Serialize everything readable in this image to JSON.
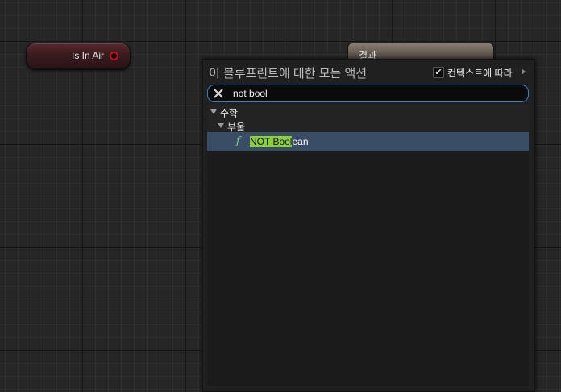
{
  "graph": {
    "node_is_in_air": {
      "label": "Is In Air"
    },
    "node_result": {
      "title": "결과"
    }
  },
  "palette": {
    "title": "이 블루프린트에 대한 모든 액션",
    "context_sensitive": {
      "label": "컨텍스트에 따라",
      "checked": true
    },
    "search": {
      "value": "not bool",
      "placeholder": ""
    },
    "categories": [
      {
        "label": "수학",
        "expanded": true
      },
      {
        "label": "부울",
        "expanded": true
      }
    ],
    "results": [
      {
        "icon": "function-icon",
        "icon_glyph": "f",
        "label_match": "NOT Bool",
        "label_rest": "ean",
        "selected": true
      }
    ]
  },
  "colors": {
    "pin_bool": "#c4121a",
    "match_highlight": "#8ccf3c",
    "selection": "#3a4d66",
    "search_border": "#3d7fc0"
  }
}
